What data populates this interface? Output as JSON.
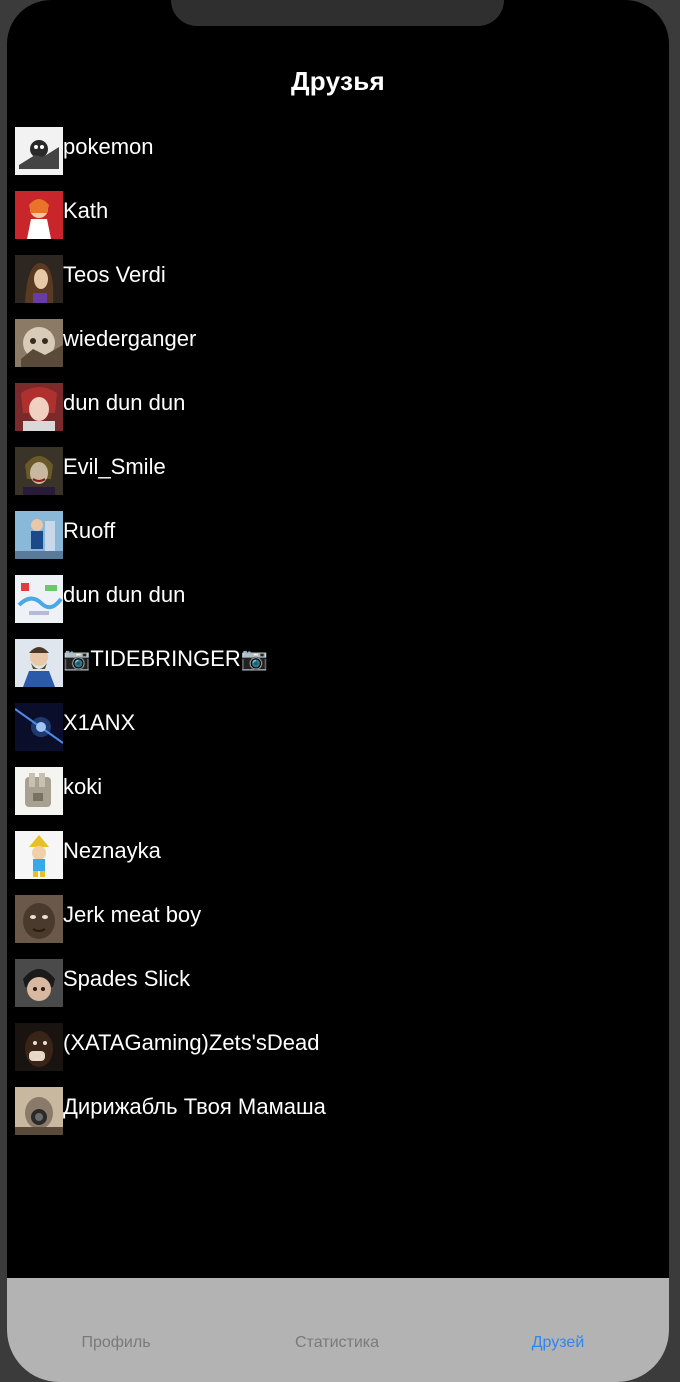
{
  "header": {
    "title": "Друзья"
  },
  "friends": [
    {
      "name": "pokemon"
    },
    {
      "name": "Kath"
    },
    {
      "name": "Teos Verdi"
    },
    {
      "name": "wiederganger"
    },
    {
      "name": "dun dun dun"
    },
    {
      "name": "Evil_Smile"
    },
    {
      "name": "Ruoff"
    },
    {
      "name": "dun dun dun"
    },
    {
      "name": "📷TIDEBRINGER📷"
    },
    {
      "name": "X1ANX"
    },
    {
      "name": "koki"
    },
    {
      "name": "Neznayka"
    },
    {
      "name": "Jerk meat boy"
    },
    {
      "name": "Spades Slick"
    },
    {
      "name": "(XATAGaming)Zets'sDead"
    },
    {
      "name": "Дирижабль Твоя Мамаша"
    }
  ],
  "tabbar": {
    "profile": "Профиль",
    "stats": "Статистика",
    "friends": "Друзей",
    "active_color": "#2f86f0",
    "inactive_color": "#7a7a7a"
  }
}
